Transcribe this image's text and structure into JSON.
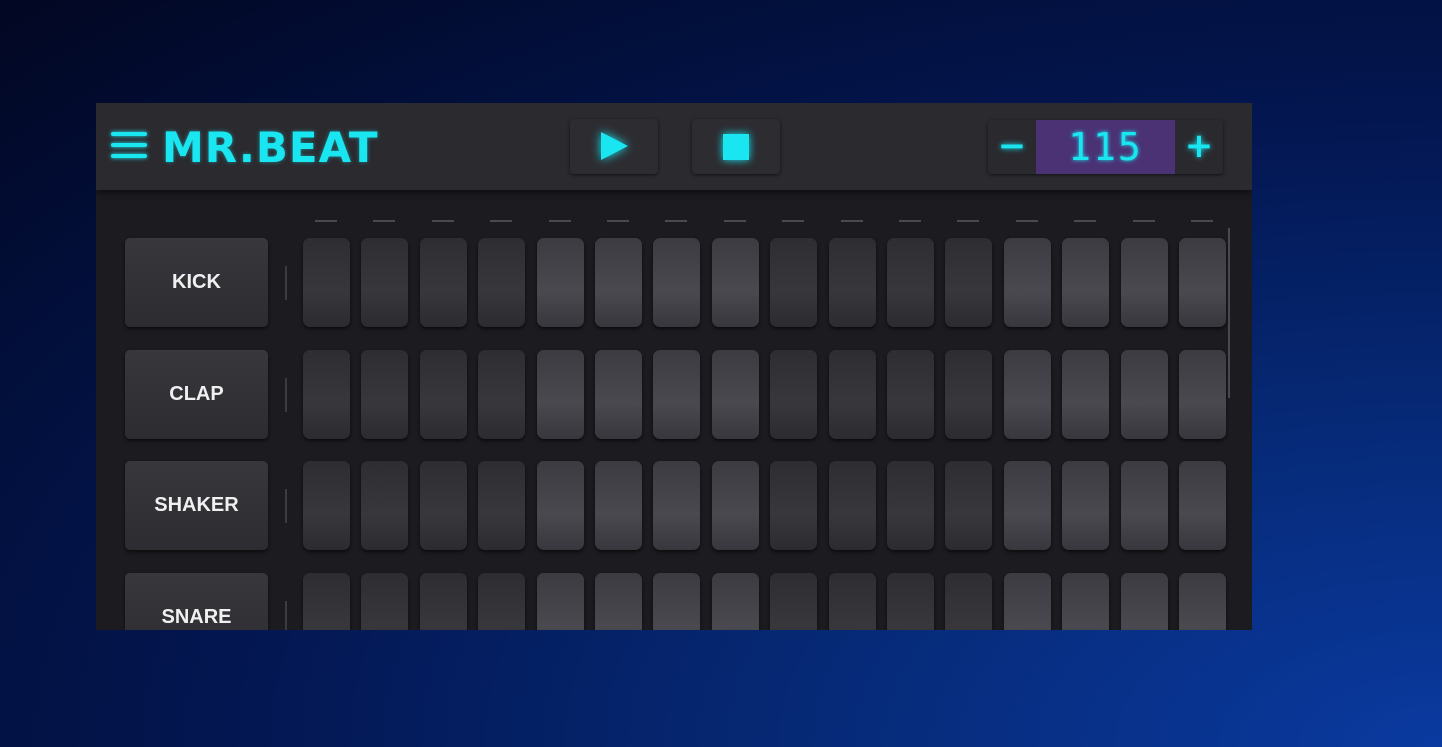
{
  "header": {
    "logo": "MR.BEAT",
    "tempo": "115",
    "minus": "−",
    "plus": "+"
  },
  "icons": {
    "menu": "hamburger-icon",
    "play": "play-icon",
    "stop": "stop-icon"
  },
  "accent": "#19e6f0",
  "steps": 16,
  "tracks": [
    {
      "label": "KICK"
    },
    {
      "label": "CLAP"
    },
    {
      "label": "SHAKER"
    },
    {
      "label": "SNARE"
    }
  ]
}
